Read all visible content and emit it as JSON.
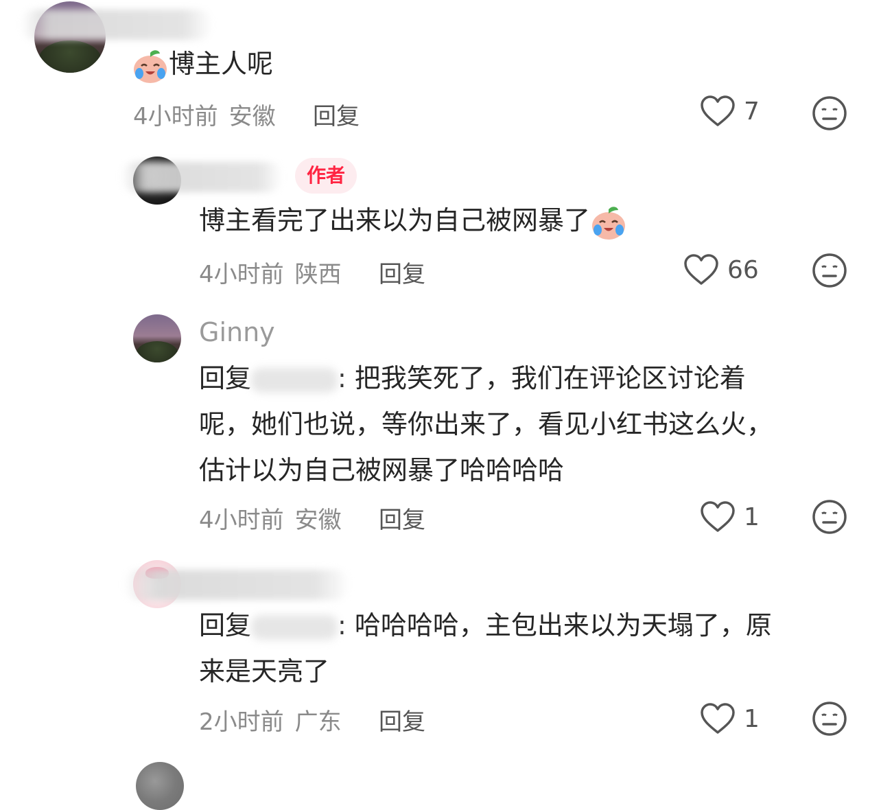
{
  "comments": [
    {
      "content": "博主人呢",
      "time": "4小时前",
      "location": "安徽",
      "reply_label": "回复",
      "likes": "7"
    },
    {
      "author_tag": "作者",
      "content": "博主看完了出来以为自己被网暴了",
      "time": "4小时前",
      "location": "陕西",
      "reply_label": "回复",
      "likes": "66"
    },
    {
      "username": "Ginny",
      "reply_prefix": "回复",
      "content_line1": ": 把我笑死了，我们在评论区讨论着",
      "content_line2": "呢，她们也说，等你出来了，看见小红书这么火，",
      "content_line3": "估计以为自己被网暴了哈哈哈哈",
      "time": "4小时前",
      "location": "安徽",
      "reply_label": "回复",
      "likes": "1"
    },
    {
      "reply_prefix": "回复",
      "content_line1": ": 哈哈哈哈，主包出来以为天塌了，原",
      "content_line2": "来是天亮了",
      "time": "2小时前",
      "location": "广东",
      "reply_label": "回复",
      "likes": "1"
    }
  ],
  "icons": {
    "like": "heart-outline-icon",
    "dislike": "meh-face-icon",
    "emoji": "crying-laughing-peach-icon"
  },
  "colors": {
    "author_tag_text": "#ff2442",
    "author_tag_bg": "#fdecef",
    "meta": "#8a8a8a",
    "text": "#262626"
  }
}
